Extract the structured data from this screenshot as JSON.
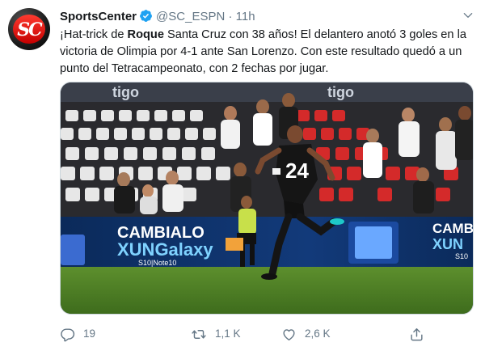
{
  "tweet": {
    "author_name": "SportsCenter",
    "handle": "@SC_ESPN",
    "separator": "·",
    "time": "11h",
    "text_parts": [
      {
        "t": "¡Hat-trick de ",
        "bold": false
      },
      {
        "t": "Roque",
        "bold": true
      },
      {
        "t": " Santa Cruz con 38 años! El delantero anotó 3 goles en la victoria de Olimpia por 4-1 ante San Lorenzo. Con este resultado quedó a un punto del Tetracampeonato, con 2 fechas por jugar.",
        "bold": false
      }
    ],
    "avatar_logo": "SC",
    "icons": {
      "verified": "verified-badge-icon",
      "menu": "chevron-down-icon",
      "reply": "reply-icon",
      "retweet": "retweet-icon",
      "like": "heart-icon",
      "share": "share-icon"
    },
    "colors": {
      "verified": "#1da1f2",
      "muted": "#657786",
      "text": "#14171a"
    }
  },
  "media": {
    "jersey_number": "24",
    "banner_sponsor_1": "tigo",
    "banner_sponsor_2": "tigo",
    "ad_line1": "CAMBIALO",
    "ad_line2": "XUNGalaxy",
    "ad_line3": "S10|Note10",
    "ad_right_line1": "CAMBIA",
    "ad_right_line2": "XUN",
    "ad_right_line3": "S10"
  },
  "actions": {
    "reply_count": "19",
    "retweet_count": "1,1 K",
    "like_count": "2,6 K"
  }
}
